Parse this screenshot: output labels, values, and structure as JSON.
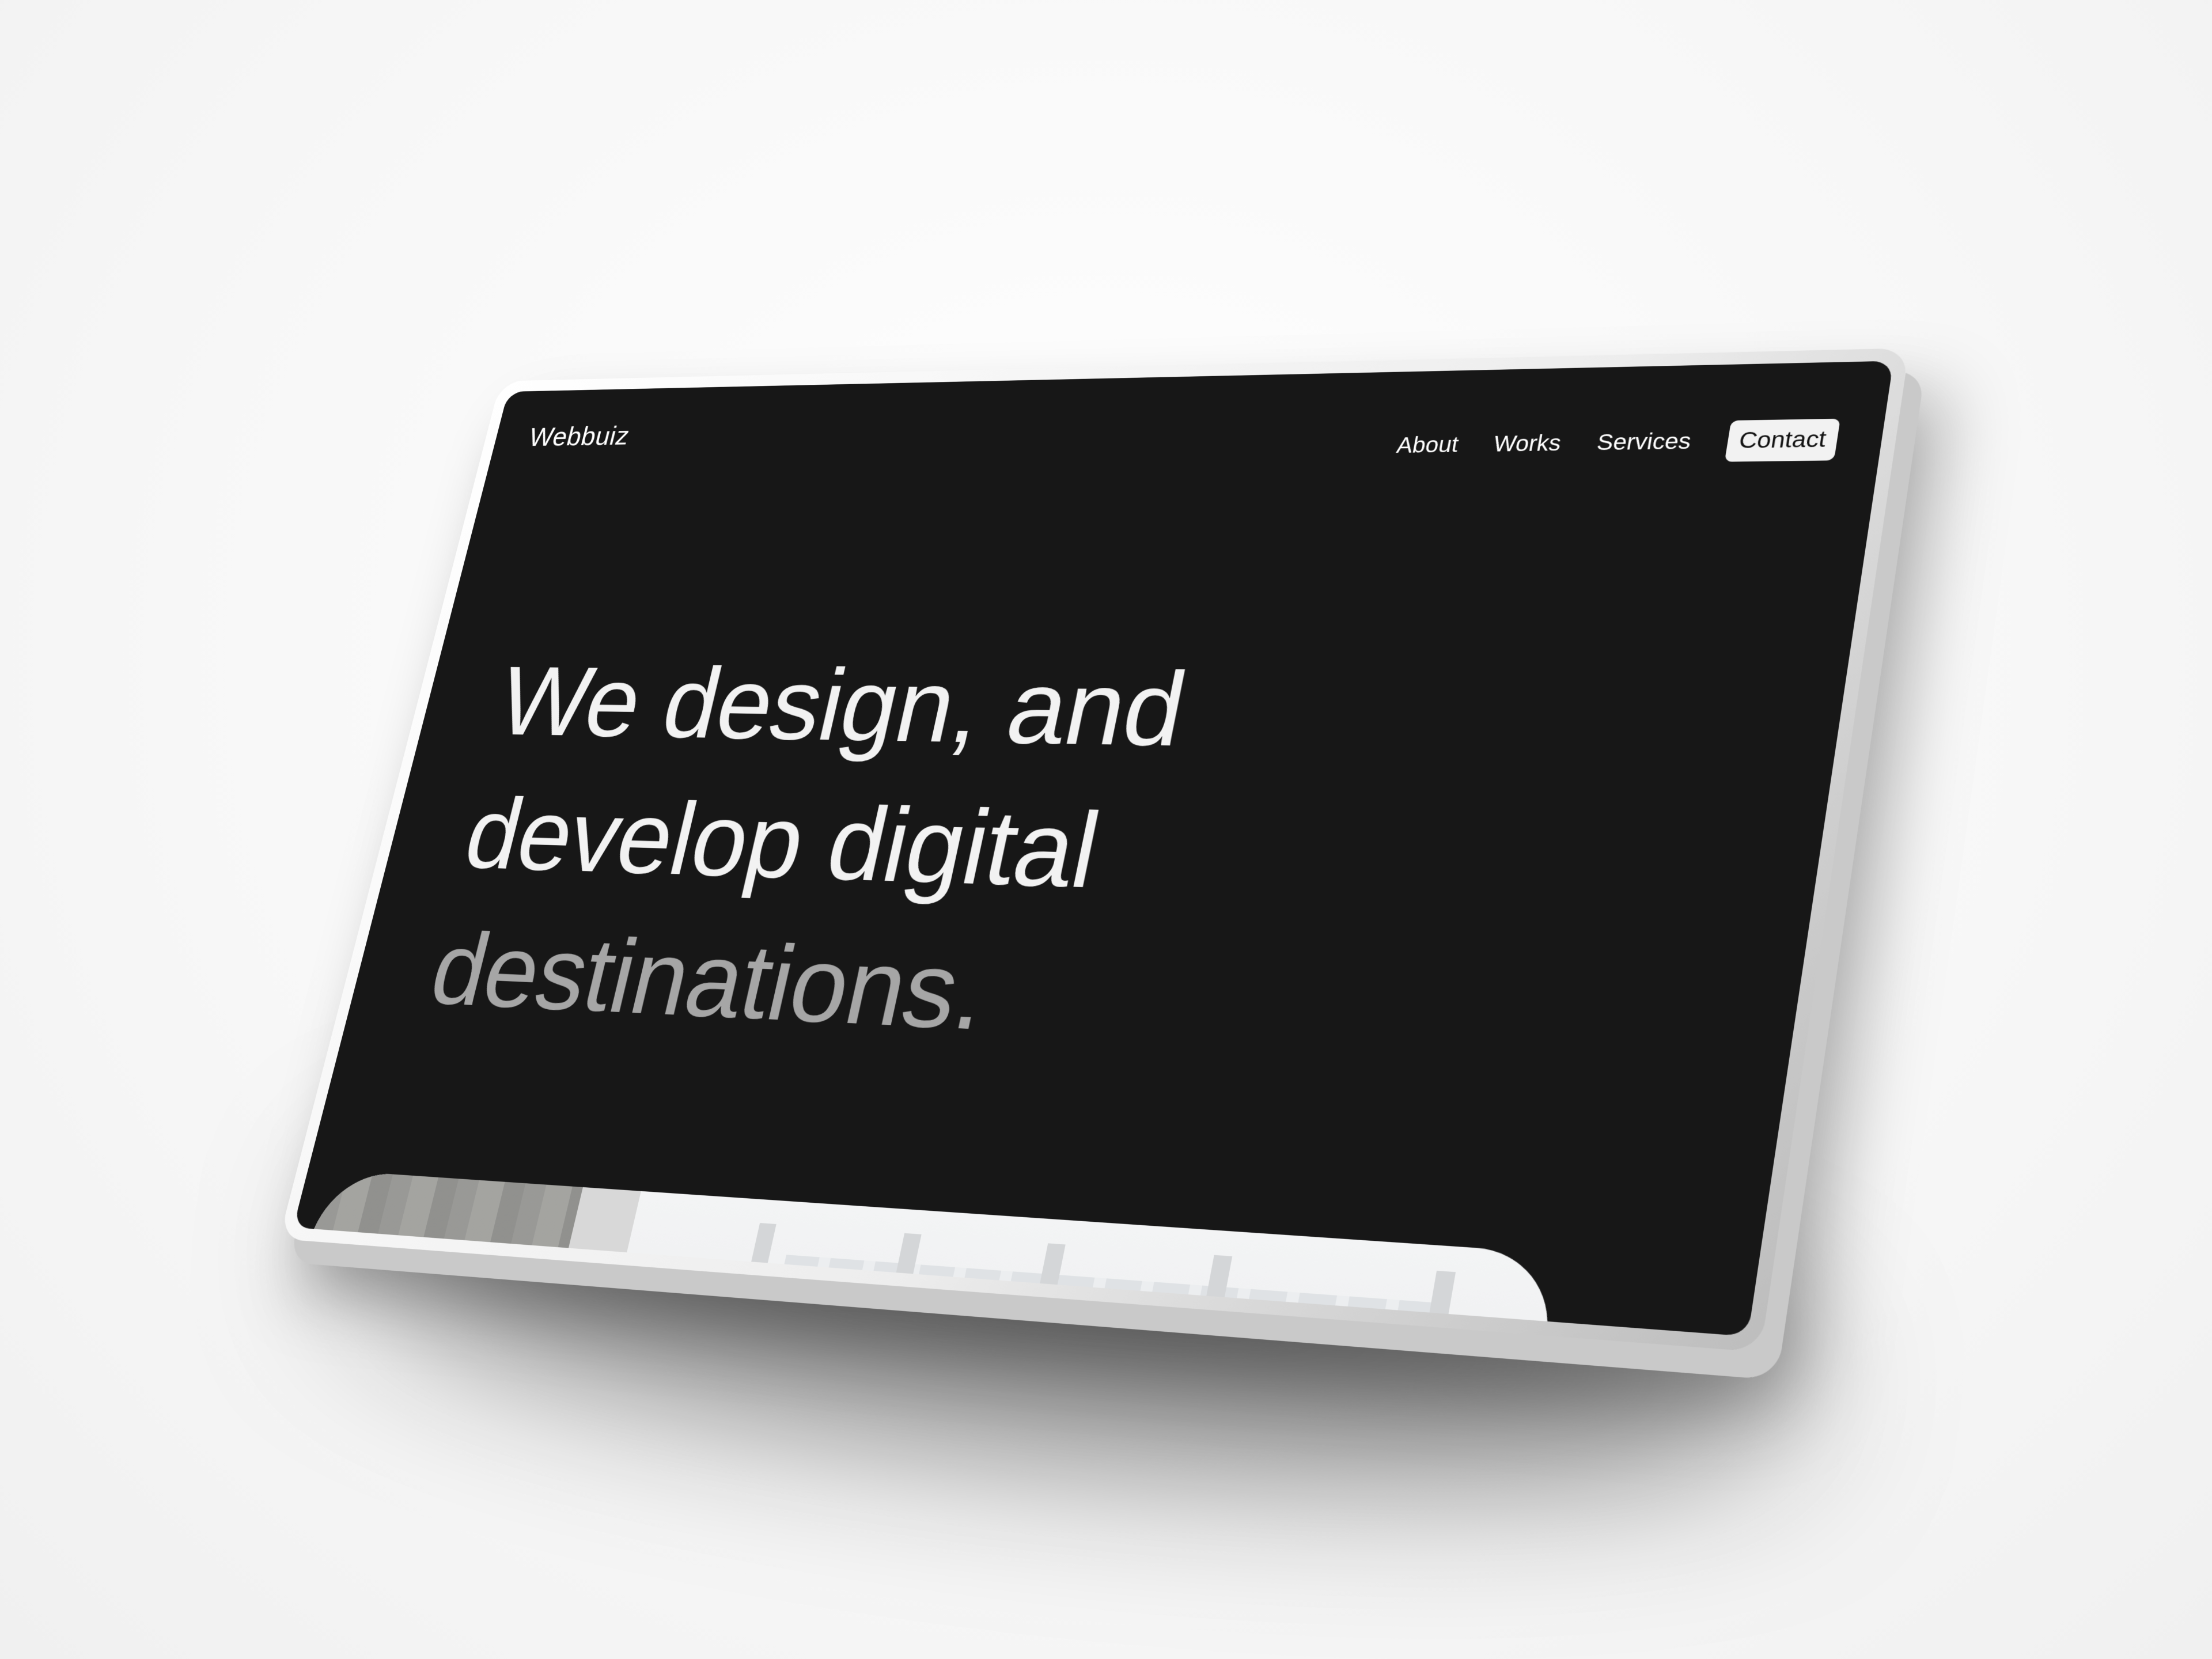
{
  "site": {
    "brand": "Webbuiz"
  },
  "nav": {
    "items": [
      {
        "label": "About"
      },
      {
        "label": "Works"
      },
      {
        "label": "Services"
      }
    ],
    "contact_label": "Contact"
  },
  "hero": {
    "line1": "We design, and",
    "line2": "develop digital",
    "line3": "destinations."
  },
  "colors": {
    "screen_bg": "#171717",
    "headline_primary": "#f2f2f2",
    "headline_muted": "#a6a6a6",
    "contact_button_bg": "#f2f2f2"
  },
  "icons": {
    "hero_photo": "office-interior-photo"
  }
}
